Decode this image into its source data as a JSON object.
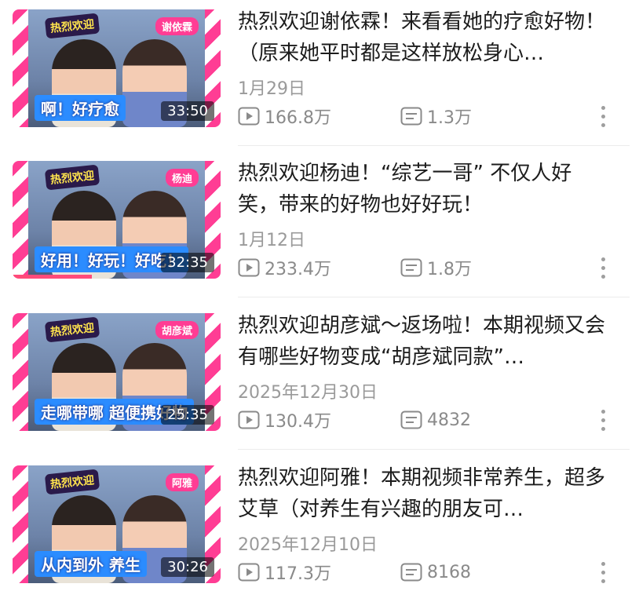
{
  "videos": [
    {
      "title": "热烈欢迎谢依霖！来看看她的疗愈好物！（原来她平时都是这样放松身心…",
      "date": "1月29日",
      "duration": "33:50",
      "views": "166.8万",
      "comments": "1.3万",
      "thumb_logo": "热烈欢迎",
      "thumb_name": "谢依霖",
      "thumb_caption": "啊！好疗愈",
      "watch_progress": 0
    },
    {
      "title": "热烈欢迎杨迪！“综艺一哥” 不仅人好笑，带来的好物也好好玩！",
      "date": "1月12日",
      "duration": "32:35",
      "views": "233.4万",
      "comments": "1.8万",
      "thumb_logo": "热烈欢迎",
      "thumb_name": "杨迪",
      "thumb_caption": "好用！好玩！好吃！",
      "watch_progress": 0.38
    },
    {
      "title": "热烈欢迎胡彦斌～返场啦！本期视频又会有哪些好物变成“胡彦斌同款”…",
      "date": "2025年12月30日",
      "duration": "25:35",
      "views": "130.4万",
      "comments": "4832",
      "thumb_logo": "热烈欢迎",
      "thumb_name": "胡彦斌",
      "thumb_caption": "走哪带哪 超便携好物",
      "watch_progress": 0
    },
    {
      "title": "热烈欢迎阿雅！本期视频非常养生，超多艾草（对养生有兴趣的朋友可…",
      "date": "2025年12月10日",
      "duration": "30:26",
      "views": "117.3万",
      "comments": "8168",
      "thumb_logo": "热烈欢迎",
      "thumb_name": "阿雅",
      "thumb_caption": "从内到外 养生",
      "watch_progress": 0
    }
  ],
  "icons": {
    "views": "play-icon",
    "comments": "danmaku-icon",
    "more": "more-vertical-icon"
  },
  "colors": {
    "stripe": "#ff3d94",
    "progress": "#ff4b7a",
    "meta": "#9a9a9a"
  }
}
